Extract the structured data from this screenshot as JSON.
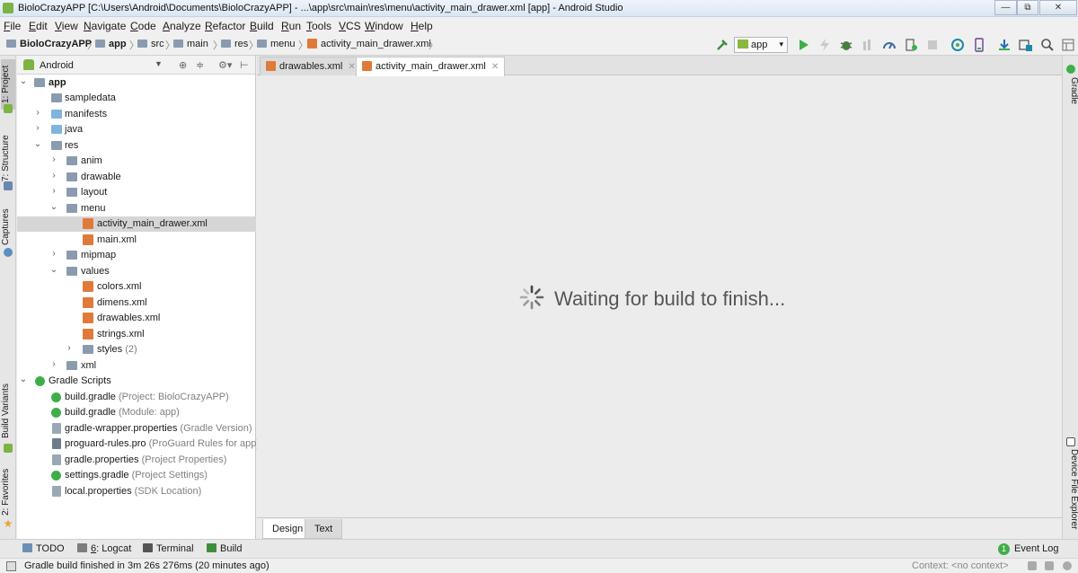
{
  "window": {
    "title": "BioloCrazyAPP [C:\\Users\\Android\\Documents\\BioloCrazyAPP] - ...\\app\\src\\main\\res\\menu\\activity_main_drawer.xml [app] - Android Studio",
    "min_glyph": "—",
    "max_glyph": "⧉",
    "close_glyph": "✕"
  },
  "menu": [
    "File",
    "Edit",
    "View",
    "Navigate",
    "Code",
    "Analyze",
    "Refactor",
    "Build",
    "Run",
    "Tools",
    "VCS",
    "Window",
    "Help"
  ],
  "breadcrumb": [
    "BioloCrazyAPP",
    "app",
    "src",
    "main",
    "res",
    "menu",
    "activity_main_drawer.xml"
  ],
  "toolbar": {
    "run_config": "app"
  },
  "left_strip": {
    "project": "1: Project",
    "structure": "7: Structure",
    "captures": "Captures",
    "build_variants": "Build Variants",
    "favorites": "2: Favorites"
  },
  "right_strip": {
    "gradle": "Gradle",
    "device_file_explorer": "Device File Explorer"
  },
  "project_panel": {
    "view": "Android",
    "tree": [
      {
        "label": "app",
        "hint": "",
        "bold": true
      },
      {
        "label": "sampledata",
        "hint": ""
      },
      {
        "label": "manifests",
        "hint": ""
      },
      {
        "label": "java",
        "hint": ""
      },
      {
        "label": "res",
        "hint": ""
      },
      {
        "label": "anim",
        "hint": ""
      },
      {
        "label": "drawable",
        "hint": ""
      },
      {
        "label": "layout",
        "hint": ""
      },
      {
        "label": "menu",
        "hint": ""
      },
      {
        "label": "activity_main_drawer.xml",
        "hint": ""
      },
      {
        "label": "main.xml",
        "hint": ""
      },
      {
        "label": "mipmap",
        "hint": ""
      },
      {
        "label": "values",
        "hint": ""
      },
      {
        "label": "colors.xml",
        "hint": ""
      },
      {
        "label": "dimens.xml",
        "hint": ""
      },
      {
        "label": "drawables.xml",
        "hint": ""
      },
      {
        "label": "strings.xml",
        "hint": ""
      },
      {
        "label": "styles",
        "hint": "(2)"
      },
      {
        "label": "xml",
        "hint": ""
      },
      {
        "label": "Gradle Scripts",
        "hint": ""
      },
      {
        "label": "build.gradle",
        "hint": "(Project: BioloCrazyAPP)"
      },
      {
        "label": "build.gradle",
        "hint": "(Module: app)"
      },
      {
        "label": "gradle-wrapper.properties",
        "hint": "(Gradle Version)"
      },
      {
        "label": "proguard-rules.pro",
        "hint": "(ProGuard Rules for app)"
      },
      {
        "label": "gradle.properties",
        "hint": "(Project Properties)"
      },
      {
        "label": "settings.gradle",
        "hint": "(Project Settings)"
      },
      {
        "label": "local.properties",
        "hint": "(SDK Location)"
      }
    ],
    "selected_item": "activity_main_drawer.xml"
  },
  "editor": {
    "tabs": [
      {
        "label": "drawables.xml",
        "active": false
      },
      {
        "label": "activity_main_drawer.xml",
        "active": true
      }
    ],
    "message": "Waiting for build to finish...",
    "bottom_tabs": [
      {
        "label": "Design",
        "active": true
      },
      {
        "label": "Text",
        "active": false
      }
    ]
  },
  "tool_windows": {
    "todo": "TODO",
    "logcat_num": "6",
    "logcat": ": Logcat",
    "terminal": "Terminal",
    "build": "Build",
    "event_log_count": "1",
    "event_log": "Event Log"
  },
  "status": {
    "text": "Gradle build finished in 3m 26s 276ms (20 minutes ago)",
    "context": "Context: <no context>"
  }
}
